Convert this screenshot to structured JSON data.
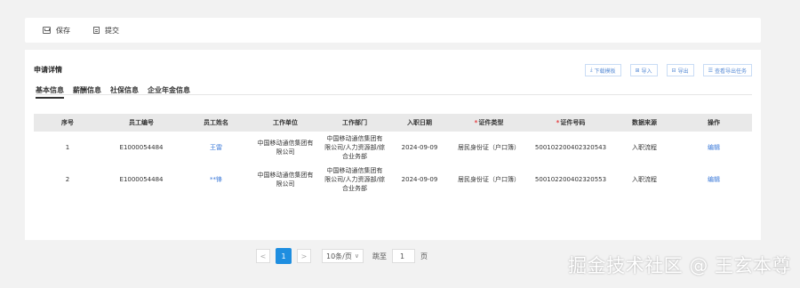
{
  "toolbar": {
    "save_label": "保存",
    "submit_label": "提交"
  },
  "panel": {
    "title": "申请详情",
    "actions": [
      {
        "icon": "download-icon",
        "label": "下载模板"
      },
      {
        "icon": "import-icon",
        "label": "导入"
      },
      {
        "icon": "export-icon",
        "label": "导出"
      },
      {
        "icon": "task-icon",
        "label": "查看导出任务"
      }
    ],
    "tabs": [
      "基本信息",
      "薪酬信息",
      "社保信息",
      "企业年金信息"
    ],
    "active_tab": "基本信息"
  },
  "table": {
    "columns": [
      "序号",
      "员工编号",
      "员工姓名",
      "工作单位",
      "工作部门",
      "入职日期",
      "证件类型",
      "证件号码",
      "数据来源",
      "操作"
    ],
    "required_columns": [
      "证件类型",
      "证件号码"
    ],
    "rows": [
      {
        "index": "1",
        "emp_no": "E1000054484",
        "name": "王雷",
        "unit_line1": "中国移动通信集团有",
        "unit_line2": "限公司",
        "dept_line1": "中国移动通信集团有",
        "dept_line2": "限公司/人力资源部/综",
        "dept_line3": "合业务部",
        "date": "2024-09-09",
        "id_type": "居民身份证（户口簿）",
        "id_no": "500102200402320543",
        "source": "入职流程",
        "action": "编辑"
      },
      {
        "index": "2",
        "emp_no": "E1000054484",
        "name": "**锋",
        "unit_line1": "中国移动通信集团有",
        "unit_line2": "限公司",
        "dept_line1": "中国移动通信集团有",
        "dept_line2": "限公司/人力资源部/综",
        "dept_line3": "合业务部",
        "date": "2024-09-09",
        "id_type": "居民身份证（户口簿）",
        "id_no": "500102200402320553",
        "source": "入职流程",
        "action": "编辑"
      }
    ]
  },
  "pager": {
    "prev": "<",
    "current": "1",
    "next": ">",
    "page_size": "10条/页",
    "jump_label": "跳至",
    "jump_value": "1",
    "page_unit": "页"
  },
  "watermark": "掘金技术社区 @ 王玄本尊",
  "colors": {
    "accent": "#1e8ee0",
    "link": "#3a78d8",
    "required": "#e4393c"
  }
}
